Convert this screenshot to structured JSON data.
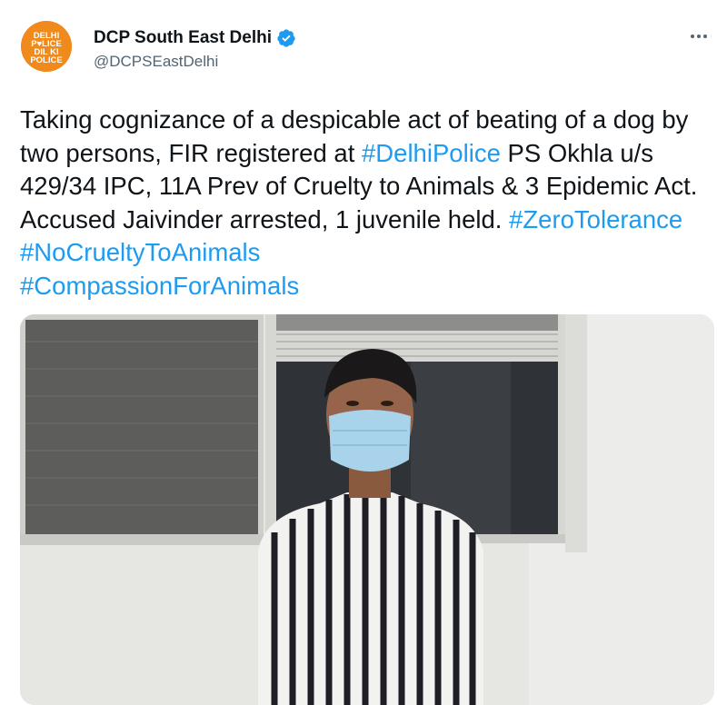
{
  "author": {
    "display_name": "DCP South East Delhi",
    "handle": "@DCPSEastDelhi",
    "verified": true,
    "avatar_text": "DELHI POLICE DIL KI POLICE"
  },
  "menu": {
    "more_icon": "more-horizontal-icon"
  },
  "tweet": {
    "text_1": "Taking cognizance of a despicable act of beating of a dog by two persons, FIR registered at ",
    "hashtag_1": "#DelhiPolice",
    "text_2": " PS Okhla u/s 429/34 IPC, 11A Prev of Cruelty to Animals & 3 Epidemic Act. Accused Jaivinder arrested, 1 juvenile held. ",
    "hashtag_2": "#ZeroTolerance",
    "text_3": " ",
    "hashtag_3": "#NoCrueltyToAnimals",
    "text_4": " ",
    "hashtag_4": "#CompassionForAnimals"
  },
  "colors": {
    "link": "#1d9bf0",
    "verified": "#1d9bf0",
    "avatar_bg": "#f08a1c",
    "text": "#0f1419",
    "secondary": "#536471"
  }
}
